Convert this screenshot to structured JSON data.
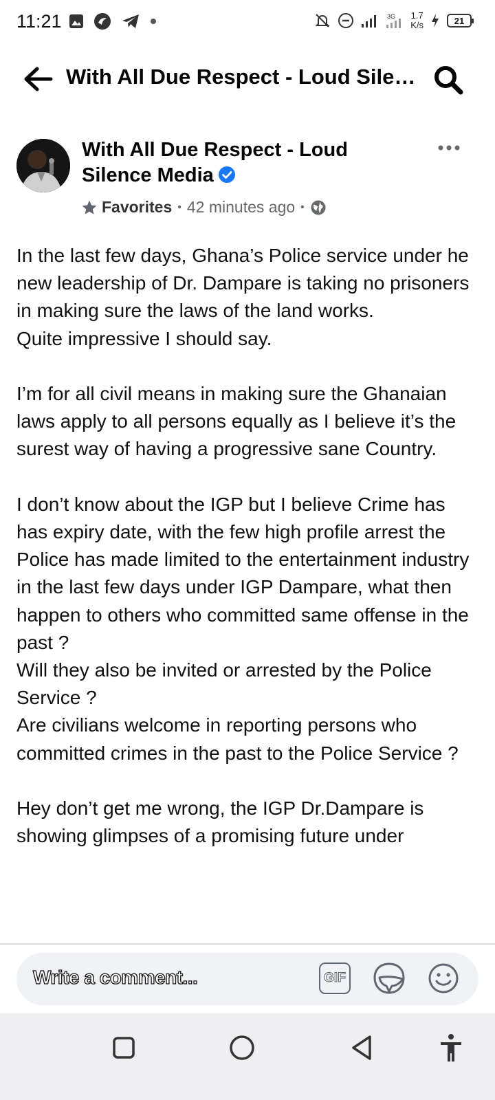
{
  "status_bar": {
    "time": "11:21",
    "net_speed_value": "1.7",
    "net_speed_unit": "K/s",
    "network_type": "3G",
    "battery": "21"
  },
  "header": {
    "title": "With All Due Respect - Loud Silence Media",
    "back_icon": "arrow-left-icon",
    "search_icon": "search-icon"
  },
  "post": {
    "author": "With All Due Respect - Loud Silence Media",
    "verified": true,
    "audience": "Favorites",
    "timestamp": "42 minutes ago",
    "privacy_icon": "globe-icon",
    "paragraphs": [
      "In the last few days, Ghana’s Police service under he new leadership of Dr. Dampare is taking no prisoners in making sure the laws of the land works.\nQuite impressive I should say.",
      "I’m for all civil means in making sure the Ghanaian laws apply to all persons equally as I believe it’s the surest way of having a progressive sane Country.",
      "I don’t know about the IGP but I believe Crime has has expiry date, with the few high profile arrest the Police has made limited to the entertainment industry in the last few days under IGP Dampare, what then happen to others who committed same offense in the past ?\nWill they also be invited or arrested by the Police Service ?\nAre civilians welcome in reporting persons who committed crimes in the past to the Police Service ?",
      "Hey don’t get me wrong, the IGP Dr.Dampare is showing glimpses of a promising future under"
    ]
  },
  "comment_bar": {
    "placeholder": "Write a comment...",
    "gif_label": "GIF"
  },
  "colors": {
    "verified_blue": "#1877f2",
    "icon_gray": "#606770",
    "meta_gray": "#65676b",
    "comment_bg": "#f0f2f5",
    "nav_bg": "#efeff1"
  }
}
